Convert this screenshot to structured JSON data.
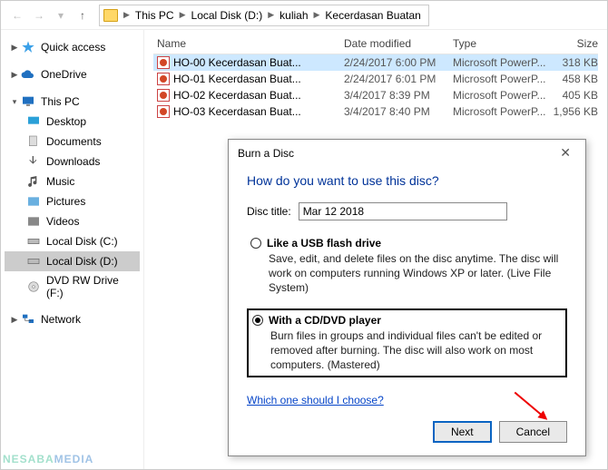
{
  "breadcrumb": {
    "parts": [
      "This PC",
      "Local Disk (D:)",
      "kuliah",
      "Kecerdasan Buatan"
    ]
  },
  "sidebar": {
    "quick_access": "Quick access",
    "onedrive": "OneDrive",
    "this_pc": "This PC",
    "desktop": "Desktop",
    "documents": "Documents",
    "downloads": "Downloads",
    "music": "Music",
    "pictures": "Pictures",
    "videos": "Videos",
    "disk_c": "Local Disk (C:)",
    "disk_d": "Local Disk (D:)",
    "dvd": "DVD RW Drive (F:)",
    "network": "Network"
  },
  "headers": {
    "name": "Name",
    "date": "Date modified",
    "type": "Type",
    "size": "Size"
  },
  "files": [
    {
      "name": "HO-00 Kecerdasan Buat...",
      "date": "2/24/2017 6:00 PM",
      "type": "Microsoft PowerP...",
      "size": "318 KB"
    },
    {
      "name": "HO-01 Kecerdasan Buat...",
      "date": "2/24/2017 6:01 PM",
      "type": "Microsoft PowerP...",
      "size": "458 KB"
    },
    {
      "name": "HO-02 Kecerdasan Buat...",
      "date": "3/4/2017 8:39 PM",
      "type": "Microsoft PowerP...",
      "size": "405 KB"
    },
    {
      "name": "HO-03 Kecerdasan Buat...",
      "date": "3/4/2017 8:40 PM",
      "type": "Microsoft PowerP...",
      "size": "1,956 KB"
    }
  ],
  "dialog": {
    "title": "Burn a Disc",
    "heading": "How do you want to use this disc?",
    "disc_title_label": "Disc title:",
    "disc_title_value": "Mar 12 2018",
    "opt1_title": "Like a USB flash drive",
    "opt1_desc": "Save, edit, and delete files on the disc anytime. The disc will work on computers running Windows XP or later. (Live File System)",
    "opt2_title": "With a CD/DVD player",
    "opt2_desc": "Burn files in groups and individual files can't be edited or removed after burning. The disc will also work on most computers. (Mastered)",
    "help_link": "Which one should I choose?",
    "next": "Next",
    "cancel": "Cancel"
  },
  "watermark": {
    "a": "NESABA",
    "b": "MEDIA"
  }
}
